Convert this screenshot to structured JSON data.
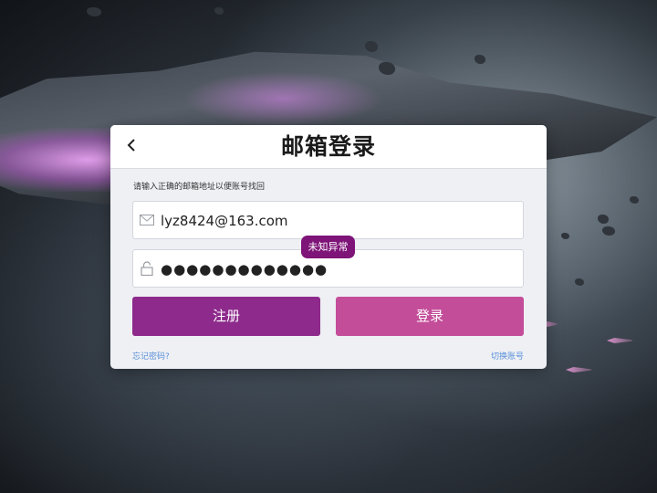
{
  "dialog": {
    "title": "邮箱登录",
    "hint": "请输入正确的邮箱地址以便账号找回",
    "email": {
      "value": "lyz8424@163.com",
      "icon": "mail-icon"
    },
    "password": {
      "value": "●●●●●●●●●●●●●",
      "icon": "lock-icon"
    },
    "error_tag": "未知异常",
    "register_label": "注册",
    "login_label": "登录",
    "forgot_label": "忘记密码?",
    "switch_label": "切换账号"
  },
  "colors": {
    "register": "#8e2a8c",
    "login": "#c44d9a",
    "tag": "#7e1478",
    "link": "#5a8fd8"
  }
}
